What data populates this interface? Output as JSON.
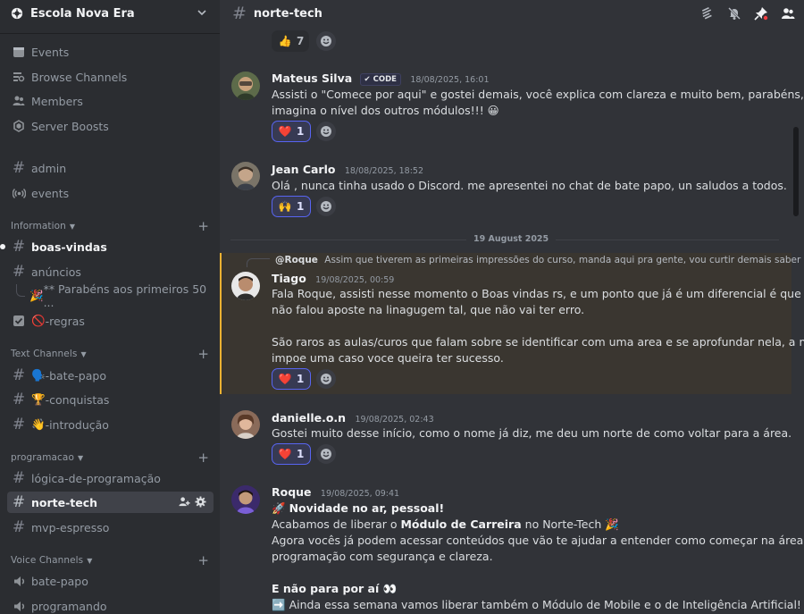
{
  "server": {
    "name": "Escola Nova Era"
  },
  "sidebar": {
    "nav": [
      {
        "label": "Events",
        "icon": "calendar-icon"
      },
      {
        "label": "Browse Channels",
        "icon": "browse-channels-icon"
      },
      {
        "label": "Members",
        "icon": "members-icon"
      },
      {
        "label": "Server Boosts",
        "icon": "boost-icon"
      }
    ],
    "top_channels": [
      {
        "label": "admin",
        "icon": "hash-icon"
      },
      {
        "label": "events",
        "icon": "broadcast-icon"
      }
    ],
    "categories": {
      "information": "Information",
      "text_channels": "Text Channels",
      "programacao": "programacao",
      "voice_channels": "Voice Channels"
    },
    "information_channels": [
      {
        "label": "boas-vindas",
        "unread": true
      },
      {
        "label": "anúncios"
      },
      {
        "label": "** Parabéns aos primeiros 50 ...",
        "thread": true,
        "emoji": "🎉"
      },
      {
        "label": "-regras",
        "emoji": "🚫",
        "icon": "rules-icon"
      }
    ],
    "text_channels": [
      {
        "label": "-bate-papo",
        "emoji": "🗣️"
      },
      {
        "label": "-conquistas",
        "emoji": "🏆"
      },
      {
        "label": "-introdução",
        "emoji": "👋"
      }
    ],
    "programacao_channels": [
      {
        "label": "lógica-de-programação"
      },
      {
        "label": "norte-tech",
        "active": true
      },
      {
        "label": "mvp-espresso"
      }
    ],
    "voice_channels": [
      {
        "label": "bate-papo"
      },
      {
        "label": "programando"
      }
    ]
  },
  "channel": {
    "name": "norte-tech"
  },
  "messages": {
    "top_reaction": {
      "emoji": "👍",
      "count": "7"
    },
    "mateus": {
      "author": "Mateus Silva",
      "tag": "CODE",
      "timestamp": "18/08/2025, 16:01",
      "line1": "Assisti o \"Comece por aqui\" e gostei demais, você explica com clareza e muito bem, parabéns,",
      "line2": "imagina o nível dos outros módulos!!! 😀",
      "reaction": {
        "emoji": "❤️",
        "count": "1"
      }
    },
    "jean": {
      "author": "Jean Carlo",
      "timestamp": "18/08/2025, 18:52",
      "line1": "Olá , nunca tinha usado o Discord. me apresentei no chat de bate papo, un saludos a todos.",
      "reaction": {
        "emoji": "🙌",
        "count": "1"
      }
    },
    "date_divider": "19 August 2025",
    "tiago": {
      "reply": {
        "name": "@Roque",
        "text": "Assim que tiverem as primeiras impressões do curso, manda aqui pra gente, vou curtir demais saber o..."
      },
      "author": "Tiago",
      "timestamp": "19/08/2025, 00:59",
      "line1": "Fala Roque, assisti nesse momento o Boas vindas rs, e um ponto que já é um diferencial é que voce",
      "line2": "não falou aposte na linagugem tal, que não vai ter erro.",
      "line3": "São raros as aulas/curos que falam sobre se identificar com uma area e se aprofundar nela, a maioria",
      "line4": "impoe uma caso voce queira ter sucesso.",
      "reaction": {
        "emoji": "❤️",
        "count": "1"
      }
    },
    "danielle": {
      "author": "danielle.o.n",
      "timestamp": "19/08/2025, 02:43",
      "line1": "Gostei muito desse início, como o nome já diz, me deu um norte de como voltar para a área.",
      "reaction": {
        "emoji": "❤️",
        "count": "1"
      }
    },
    "roque": {
      "author": "Roque",
      "timestamp": "19/08/2025, 09:41",
      "headline_emoji": "🚀",
      "headline": "Novidade no ar, pessoal!",
      "line2_a": "Acabamos de liberar o ",
      "line2_b": "Módulo de Carreira",
      "line2_c": " no Norte-Tech 🎉",
      "line3": "Agora vocês já podem acessar conteúdos que vão te ajudar a entender como começar na área de",
      "line4": "programação com segurança e clareza.",
      "line5": "E não para por aí 👀",
      "line6_emoji": "➡️",
      "line6": "Ainda essa semana vamos liberar também o Módulo de Mobile e o de Inteligência Artificial!"
    }
  },
  "colors": {
    "sidebar_bg": "#2b2d31",
    "chat_bg": "#313338",
    "active_channel": "#404249",
    "mention_highlight": "#f0b232",
    "reaction_accent": "#5865f2"
  }
}
